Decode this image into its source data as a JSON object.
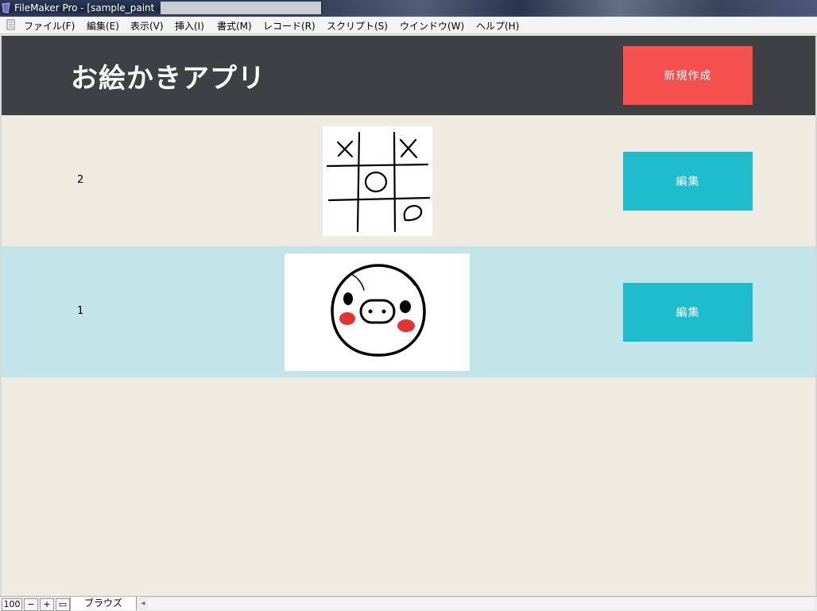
{
  "window": {
    "title": "FileMaker Pro - [sample_paint"
  },
  "menu": [
    {
      "label": "ファイル(F)"
    },
    {
      "label": "編集(E)"
    },
    {
      "label": "表示(V)"
    },
    {
      "label": "挿入(I)"
    },
    {
      "label": "書式(M)"
    },
    {
      "label": "レコード(R)"
    },
    {
      "label": "スクリプト(S)"
    },
    {
      "label": "ウインドウ(W)"
    },
    {
      "label": "ヘルプ(H)"
    }
  ],
  "header": {
    "title": "お絵かきアプリ",
    "new_button": "新規作成",
    "colors": {
      "bar": "#3e4043",
      "new_button": "#f4504e"
    }
  },
  "records": [
    {
      "number": "2",
      "thumbnail": "tic-tac-toe-drawing",
      "edit_label": "編集",
      "row_color": "#f0ebe0"
    },
    {
      "number": "1",
      "thumbnail": "pig-face-drawing",
      "edit_label": "編集",
      "row_color": "#c1e5e9"
    }
  ],
  "colors": {
    "edit_button": "#1fbccd",
    "background": "#f0ebe0"
  },
  "statusbar": {
    "zoom": "100",
    "mode": "ブラウズ"
  }
}
